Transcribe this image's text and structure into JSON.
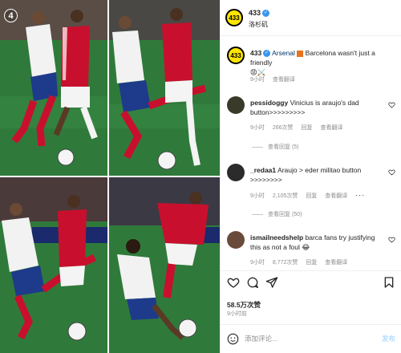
{
  "media": {
    "slide_number": "4"
  },
  "post": {
    "author": "433",
    "avatar_text": "433",
    "location": "洛杉矶",
    "caption_mention": "Arsenal",
    "caption_text": "Barcelona wasn't just a friendly",
    "caption_emojis": "😡⚔️",
    "caption_time": "9小时",
    "see_translation": "查看翻译"
  },
  "comments": [
    {
      "username": "pessidoggy",
      "text": "Vinicius is araujo's dad button>>>>>>>>>",
      "time": "9小时",
      "likes": "266次赞",
      "reply": "回复",
      "translate": "查看翻译",
      "view_replies": "查看回复 (5)",
      "avatar_color": "#3a3a2a"
    },
    {
      "username": "_redaa1",
      "text": "Araujo > eder militao button >>>>>>>>",
      "time": "9小时",
      "likes": "2,105次赞",
      "reply": "回复",
      "translate": "查看翻译",
      "more": "···",
      "view_replies": "查看回复 (50)",
      "avatar_color": "#2b2b2b"
    },
    {
      "username": "ismailneedshelp",
      "text": "barca fans try justifying this as not a foul 😂",
      "time": "9小时",
      "likes": "8,772次赞",
      "reply": "回复",
      "translate": "查看翻译",
      "avatar_color": "#6a4a3a"
    }
  ],
  "actions": {
    "likes_count": "58.5万次赞",
    "time_ago": "9小时前"
  },
  "compose": {
    "placeholder": "添加评论...",
    "post_label": "发布"
  },
  "colors": {
    "accent_blue": "#3897f0",
    "brand_yellow": "#ffe600",
    "arsenal_red": "#c8102e",
    "barca_blue": "#1e3a8a",
    "pitch_green": "#2f7a3a",
    "muted_text": "#8e8e8e"
  }
}
